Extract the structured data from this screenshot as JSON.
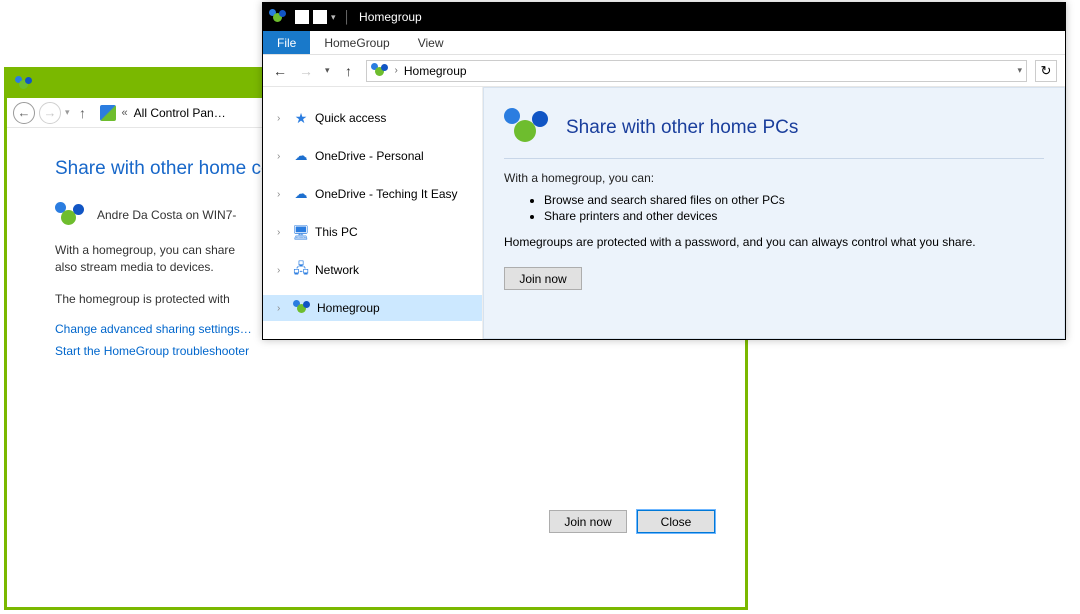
{
  "cp": {
    "breadcrumb": "All Control Pan…",
    "heading": "Share with other home co",
    "user_line": "Andre Da Costa on WIN7-",
    "body1": "With a homegroup, you can share",
    "body2": "also stream media to devices.",
    "body3": "The homegroup is protected with",
    "link1": "Change advanced sharing settings…",
    "link2": "Start the HomeGroup troubleshooter",
    "btn_join": "Join now",
    "btn_close": "Close"
  },
  "explorer": {
    "title": "Homegroup",
    "tabs": {
      "file": "File",
      "homegroup": "HomeGroup",
      "view": "View"
    },
    "addr_crumb": "Homegroup",
    "tree": {
      "quick_access": "Quick access",
      "onedrive_personal": "OneDrive - Personal",
      "onedrive_teching": "OneDrive - Teching It Easy",
      "this_pc": "This PC",
      "network": "Network",
      "homegroup": "Homegroup"
    },
    "pane": {
      "heading": "Share with other home PCs",
      "sub": "With a homegroup, you can:",
      "bullet1": "Browse and search shared files on other PCs",
      "bullet2": "Share printers and other devices",
      "note": "Homegroups are protected with a password, and you can always control what you share.",
      "btn_join": "Join now"
    }
  }
}
